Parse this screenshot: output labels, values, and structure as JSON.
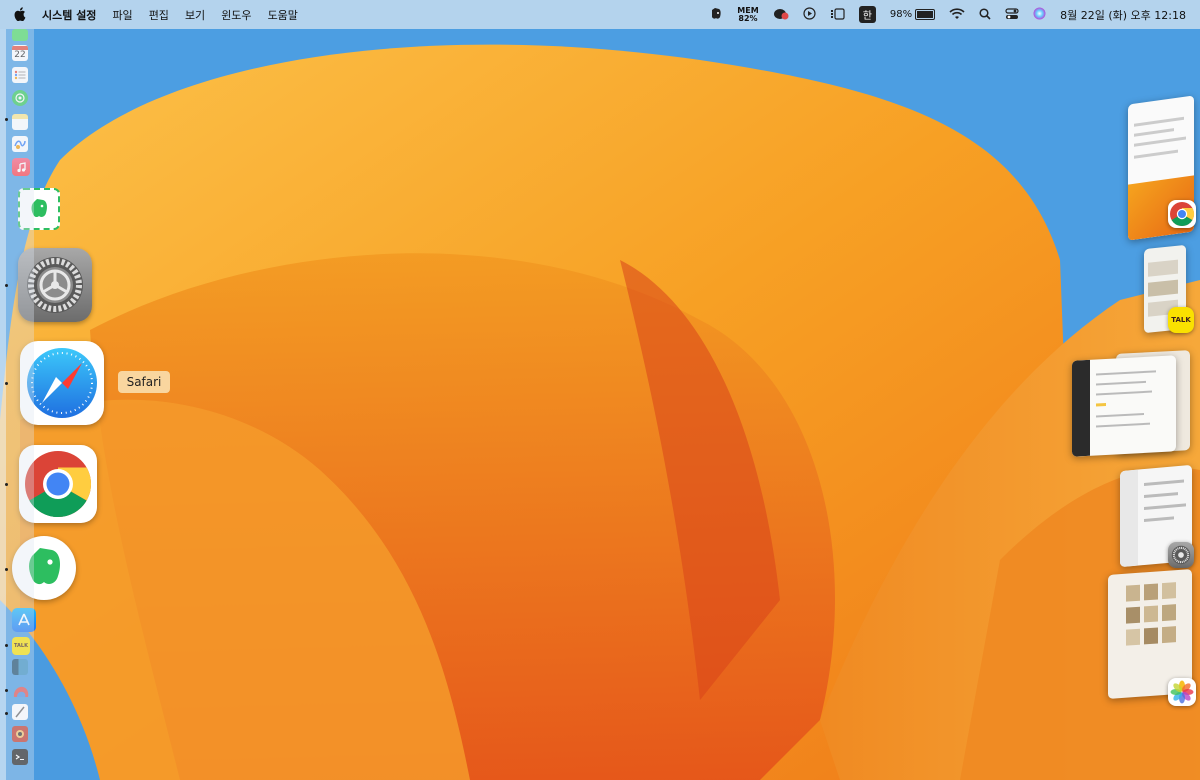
{
  "menubar": {
    "apple_icon": "apple-logo",
    "app_name": "시스템 설정",
    "menus": [
      "파일",
      "편집",
      "보기",
      "윈도우",
      "도움말"
    ],
    "status": {
      "mem_label": "MEM",
      "mem_value": "82%",
      "input_method": "한",
      "battery_percent": "98%",
      "battery_level": 0.98,
      "datetime": "8월 22일 (화) 오후 12:18"
    }
  },
  "dock": {
    "tooltip": "Safari",
    "items": [
      {
        "name": "Messages",
        "icon": "messages-icon"
      },
      {
        "name": "Calendar",
        "icon": "calendar-icon",
        "text": "22"
      },
      {
        "name": "Reminders",
        "icon": "reminders-icon"
      },
      {
        "name": "Find My",
        "icon": "findmy-icon"
      },
      {
        "name": "Notes",
        "icon": "notes-icon"
      },
      {
        "name": "Freeform",
        "icon": "freeform-icon"
      },
      {
        "name": "Music",
        "icon": "music-icon"
      },
      {
        "name": "Evernote (dragging)",
        "icon": "evernote-icon"
      },
      {
        "name": "System Settings",
        "icon": "system-settings-icon"
      },
      {
        "name": "Safari",
        "icon": "safari-icon"
      },
      {
        "name": "Chrome",
        "icon": "chrome-icon"
      },
      {
        "name": "Evernote",
        "icon": "evernote-icon"
      },
      {
        "name": "App Store",
        "icon": "appstore-icon"
      },
      {
        "name": "KakaoTalk",
        "icon": "kakaotalk-icon",
        "text": "TALK"
      },
      {
        "name": "Sidebar app",
        "icon": "app-icon"
      },
      {
        "name": "Cloud app",
        "icon": "cloud-app-icon"
      },
      {
        "name": "TextEdit",
        "icon": "textedit-icon"
      },
      {
        "name": "Photo Booth",
        "icon": "camera-app-icon"
      },
      {
        "name": "Terminal",
        "icon": "terminal-icon"
      }
    ]
  },
  "stage_manager": {
    "apps": [
      {
        "name": "Chrome",
        "icon": "chrome-icon"
      },
      {
        "name": "KakaoTalk",
        "icon": "kakaotalk-icon",
        "text": "TALK"
      },
      {
        "name": "Notes window",
        "icon": "notes-window"
      },
      {
        "name": "System Settings",
        "icon": "system-settings-icon"
      },
      {
        "name": "Photos",
        "icon": "photos-icon"
      }
    ]
  }
}
